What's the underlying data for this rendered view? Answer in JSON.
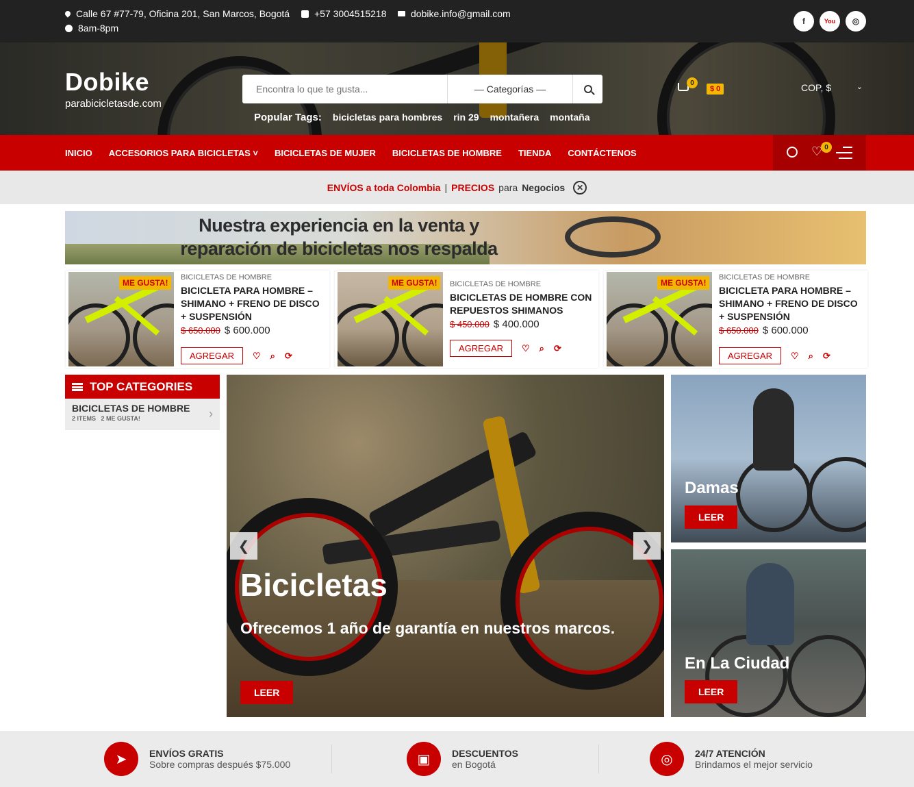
{
  "topbar": {
    "address": "Calle 67 #77-79, Oficina 201, San Marcos, Bogotá",
    "phone": "+57 3004515218",
    "email": "dobike.info@gmail.com",
    "hours": "8am-8pm",
    "social": [
      {
        "icon": "facebook-icon",
        "label": "f"
      },
      {
        "icon": "youtube-icon",
        "label": "You"
      },
      {
        "icon": "instagram-icon",
        "label": "◎"
      }
    ]
  },
  "header": {
    "logo": "Dobike",
    "tagline": "parabicicletasde.com",
    "search_placeholder": "Encontra lo que te gusta...",
    "category_select": "— Categorías —",
    "popular_label": "Popular Tags:",
    "tags": [
      "bicicletas para hombres",
      "rin 29",
      "montañera",
      "montaña"
    ],
    "cart_count": "0",
    "cart_total": "$ 0",
    "currency": "COP, $",
    "wishlist_count": "0"
  },
  "nav": {
    "items": [
      "INICIO",
      "ACCESORIOS PARA BICICLETAS",
      "BICICLETAS DE MUJER",
      "BICICLETAS DE HOMBRE",
      "TIENDA",
      "CONTÁCTENOS"
    ]
  },
  "notice": {
    "part1": "ENVÍOS a toda Colombia",
    "sep": "|",
    "part2": "PRECIOS",
    "part3": "para",
    "part4": "Negocios"
  },
  "banner": {
    "line1": "Nuestra experiencia en la venta y",
    "line2": "reparación de bicicletas nos respalda"
  },
  "products": [
    {
      "badge": "ME GUSTA!",
      "category": "BICICLETAS DE HOMBRE",
      "title": "BICICLETA PARA HOMBRE – SHIMANO + FRENO DE DISCO + SUSPENSIÓN",
      "old_price": "$ 650.000",
      "price": "$ 600.000",
      "button": "AGREGAR"
    },
    {
      "badge": "ME GUSTA!",
      "category": "BICICLETAS DE HOMBRE",
      "title": "BICICLETAS DE HOMBRE CON REPUESTOS SHIMANOS",
      "old_price": "$ 450.000",
      "price": "$ 400.000",
      "button": "AGREGAR"
    },
    {
      "badge": "ME GUSTA!",
      "category": "BICICLETAS DE HOMBRE",
      "title": "BICICLETA PARA HOMBRE – SHIMANO + FRENO DE DISCO + SUSPENSIÓN",
      "old_price": "$ 650.000",
      "price": "$ 600.000",
      "button": "AGREGAR"
    }
  ],
  "sidebar": {
    "title": "TOP CATEGORIES",
    "category": "BICICLETAS DE HOMBRE",
    "meta": "2 ITEMS   2 ME GUSTA!"
  },
  "slider": {
    "title": "Bicicletas",
    "subtitle": "Ofrecemos 1 año de garantía en nuestros marcos.",
    "button": "LEER",
    "prev": "❮",
    "next": "❯"
  },
  "promos": [
    {
      "title": "Damas",
      "button": "LEER"
    },
    {
      "title": "En La Ciudad",
      "button": "LEER"
    }
  ],
  "features": [
    {
      "title": "ENVÍOS GRATIS",
      "sub": "Sobre compras después $75.000"
    },
    {
      "title": "DESCUENTOS",
      "sub": "en Bogotá"
    },
    {
      "title": "24/7 ATENCIÓN",
      "sub": "Brindamos el mejor servicio"
    }
  ],
  "colors": {
    "brand_red": "#c80000",
    "badge_yellow": "#f2b705",
    "topbar": "#222222"
  }
}
